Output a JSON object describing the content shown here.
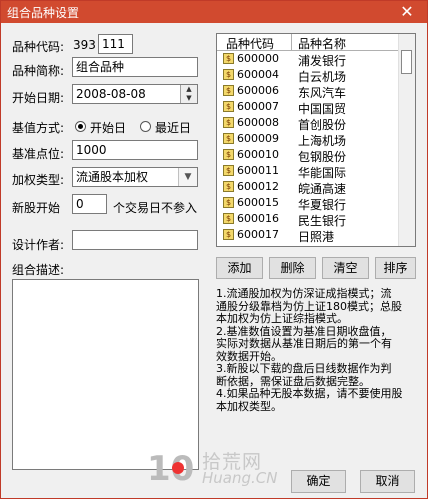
{
  "window": {
    "title": "组合品种设置",
    "close_glyph": "✕"
  },
  "form": {
    "code_label": "品种代码:",
    "code_prefix": "393",
    "code_value": "111",
    "abbr_label": "品种简称:",
    "abbr_value": "组合品种",
    "start_label": "开始日期:",
    "start_value": "2008-08-08",
    "base_mode_label": "基值方式:",
    "base_mode_opt1": "开始日",
    "base_mode_opt2": "最近日",
    "base_mode_selected": "开始日",
    "base_point_label": "基准点位:",
    "base_point_value": "1000",
    "weight_label": "加权类型:",
    "weight_value": "流通股本加权",
    "new_stock_label": "新股开始",
    "new_stock_value": "0",
    "new_stock_suffix": "个交易日不参入",
    "author_label": "设计作者:",
    "author_value": "",
    "desc_label": "组合描述:",
    "desc_value": ""
  },
  "list": {
    "headers": [
      "品种代码",
      "品种名称"
    ],
    "rows": [
      {
        "code": "600000",
        "name": "浦发银行"
      },
      {
        "code": "600004",
        "name": "白云机场"
      },
      {
        "code": "600006",
        "name": "东风汽车"
      },
      {
        "code": "600007",
        "name": "中国国贸"
      },
      {
        "code": "600008",
        "name": "首创股份"
      },
      {
        "code": "600009",
        "name": "上海机场"
      },
      {
        "code": "600010",
        "name": "包钢股份"
      },
      {
        "code": "600011",
        "name": "华能国际"
      },
      {
        "code": "600012",
        "name": "皖通高速"
      },
      {
        "code": "600015",
        "name": "华夏银行"
      },
      {
        "code": "600016",
        "name": "民生银行"
      },
      {
        "code": "600017",
        "name": "日照港"
      }
    ],
    "row_icon": "$"
  },
  "buttons": {
    "add": "添加",
    "delete": "删除",
    "clear": "清空",
    "sort": "排序",
    "ok": "确定",
    "cancel": "取消"
  },
  "help_lines": [
    "1.流通股加权为仿深证成指模式；流",
    "通股分级靠档为仿上证180模式；总股",
    "本加权为仿上证综指模式。",
    "2.基准数值设置为基准日期收盘值，",
    "实际对数据从基准日期后的第一个有",
    "效数据开始。",
    "3.新股以下载的盘后日线数据作为判",
    "断依据，需保证盘后数据完整。",
    "4.如果品种无股本数据，请不要使用股",
    "本加权类型。"
  ],
  "watermark": {
    "logo_text": "10",
    "text_top": "拾荒网",
    "text_bottom": "Huang.CN"
  },
  "colors": {
    "titlebar": "#d14a2f",
    "window_bg": "#f0f0f0",
    "watermark": "#c8c8c8",
    "logo_red": "#e33"
  }
}
